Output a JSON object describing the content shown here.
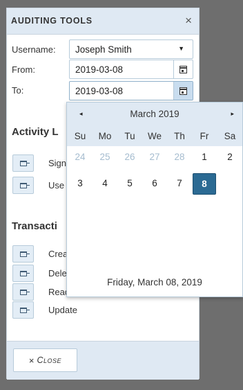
{
  "panel": {
    "title": "AUDITING TOOLS",
    "close_symbol": "×"
  },
  "form": {
    "username_label": "Username:",
    "username_value": "Joseph Smith",
    "from_label": "From:",
    "from_value": "2019-03-08",
    "to_label": "To:",
    "to_value": "2019-03-08"
  },
  "sections": {
    "activity_title": "Activity L",
    "activity_items": [
      "Sign",
      "Use"
    ],
    "transactions_title": "Transacti",
    "transaction_items": [
      "Crea",
      "Dele",
      "Read",
      "Update"
    ]
  },
  "footer": {
    "close_x": "×",
    "close_label": "Close"
  },
  "datepicker": {
    "month_label": "March 2019",
    "prev_symbol": "◂",
    "next_symbol": "▸",
    "weekdays": [
      "Su",
      "Mo",
      "Tu",
      "We",
      "Th",
      "Fr",
      "Sa"
    ],
    "weeks": [
      [
        {
          "d": "24",
          "muted": true
        },
        {
          "d": "25",
          "muted": true
        },
        {
          "d": "26",
          "muted": true
        },
        {
          "d": "27",
          "muted": true
        },
        {
          "d": "28",
          "muted": true
        },
        {
          "d": "1",
          "muted": false
        },
        {
          "d": "2",
          "muted": false
        }
      ],
      [
        {
          "d": "3",
          "muted": false
        },
        {
          "d": "4",
          "muted": false
        },
        {
          "d": "5",
          "muted": false
        },
        {
          "d": "6",
          "muted": false
        },
        {
          "d": "7",
          "muted": false
        },
        {
          "d": "8",
          "muted": false,
          "selected": true
        }
      ]
    ],
    "footer_text": "Friday, March 08, 2019"
  },
  "icons": {
    "calendar": "calendar-icon",
    "document": "document-icon",
    "chevron_down": "chevron-down-icon"
  },
  "colors": {
    "header_bg": "#dfe9f3",
    "selected_day": "#2b6a93",
    "muted_day": "#a5bccf",
    "page_bg": "#6e6e6e"
  }
}
